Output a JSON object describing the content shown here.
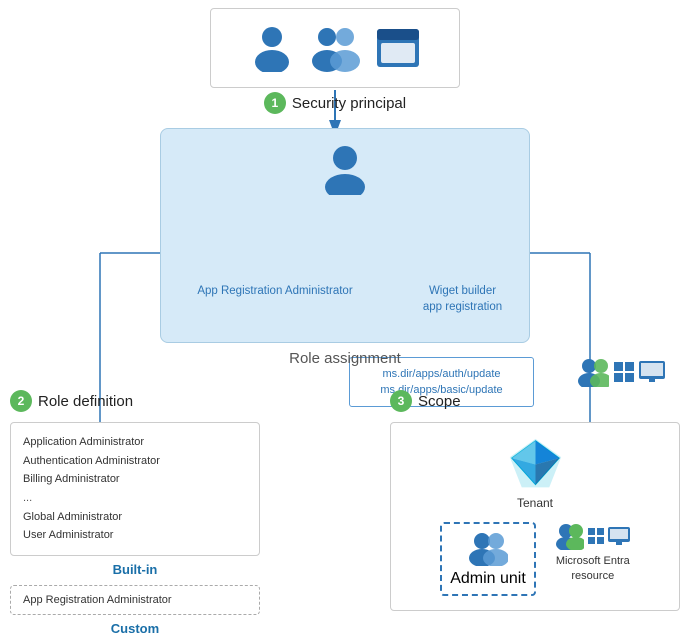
{
  "security_principal": {
    "label": "Security principal",
    "badge": "1"
  },
  "role_assignment": {
    "label": "Role assignment",
    "app_reg_lines": [
      "ms.dir/apps/auth/update",
      "ms.dir/apps/basic/update"
    ],
    "app_reg_label": "App Registration Administrator",
    "widget_label": "Wiget builder\napp registration"
  },
  "role_definition": {
    "badge": "2",
    "label": "Role definition",
    "builtin_items": [
      "Application Administrator",
      "Authentication Administrator",
      "Billing Administrator",
      "...",
      "Global Administrator",
      "User Administrator"
    ],
    "builtin_label": "Built-in",
    "custom_item": "App Registration Administrator",
    "custom_label": "Custom"
  },
  "scope": {
    "badge": "3",
    "label": "Scope",
    "tenant_label": "Tenant",
    "admin_unit_label": "Admin unit",
    "ms_entra_label": "Microsoft Entra\nresource"
  },
  "colors": {
    "blue": "#2e75b6",
    "light_blue_bg": "#d6eaf8",
    "green_badge": "#5cb85c",
    "border_gray": "#cccccc"
  }
}
